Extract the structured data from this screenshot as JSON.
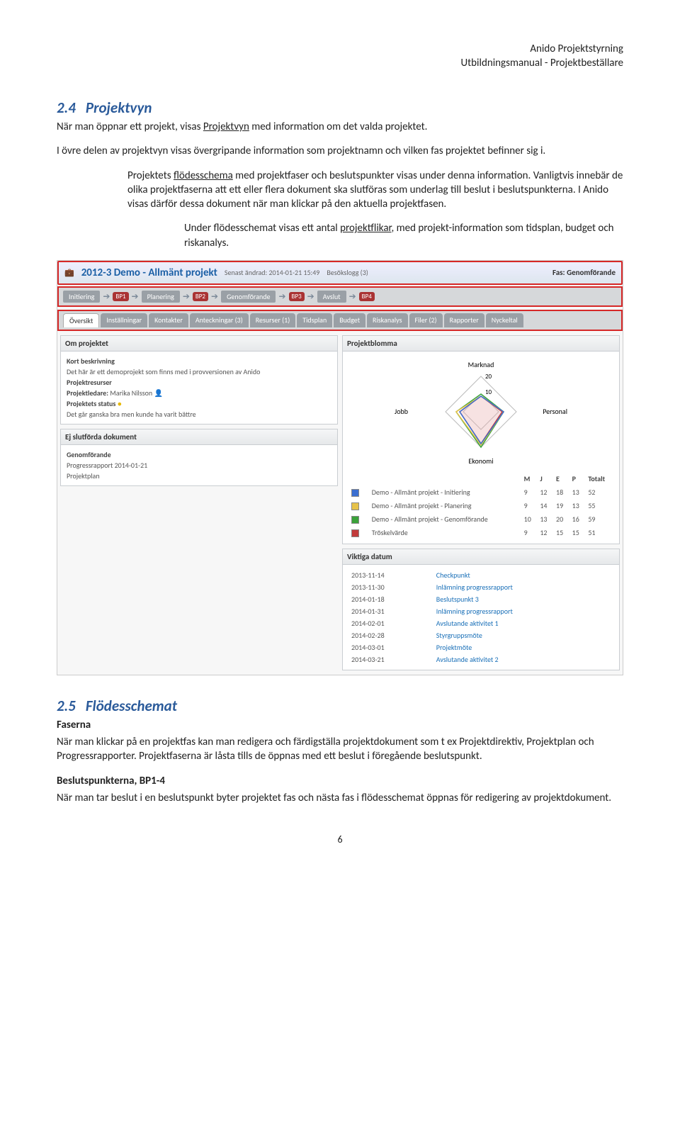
{
  "header": {
    "l1": "Anido Projektstyrning",
    "l2": "Utbildningsmanual - Projektbeställare"
  },
  "s1": {
    "num": "2.4",
    "title": "Projektvyn",
    "p1a": "När man öppnar ett projekt, visas ",
    "p1u": "Projektvyn",
    "p1b": " med information om det valda projektet.",
    "p2": "I övre delen av projektvyn visas övergripande information som projektnamn och vilken fas projektet befinner sig i.",
    "p3a": "Projektets ",
    "p3u": "flödesschema",
    "p3b": " med projektfaser och beslutspunkter visas under denna information. Vanligtvis innebär de olika projektfaserna att ett eller flera dokument ska slutföras som underlag till beslut i beslutspunkterna. I Anido visas därför dessa dokument när man klickar på den aktuella projektfasen.",
    "p4a": "Under flödesschemat visas ett antal ",
    "p4u": "projektflikar",
    "p4b": ", med projekt-information som tidsplan, budget och riskanalys."
  },
  "shot": {
    "project": "2012-3 Demo - Allmänt projekt",
    "changed": "Senast ändrad: 2014-01-21 15:49",
    "log": "Besökslogg (3)",
    "fas": "Fas: Genomförande",
    "phases": [
      "Initiering",
      "BP1",
      "Planering",
      "BP2",
      "Genomförande",
      "BP3",
      "Avslut",
      "BP4"
    ],
    "tabs": [
      "Översikt",
      "Inställningar",
      "Kontakter",
      "Anteckningar (3)",
      "Resurser (1)",
      "Tidsplan",
      "Budget",
      "Riskanalys",
      "Filer (2)",
      "Rapporter",
      "Nyckeltal"
    ],
    "about": {
      "title": "Om projektet",
      "kort_lbl": "Kort beskrivning",
      "kort": "Det här är ett demoprojekt som finns med i provversionen av Anido",
      "res_lbl": "Projektresurser",
      "leader_lbl": "Projektledare:",
      "leader": "Marika Nilsson",
      "status_lbl": "Projektets status",
      "status": "Det går ganska bra men kunde ha varit bättre"
    },
    "docs": {
      "title": "Ej slutförda dokument",
      "phase": "Genomförande",
      "d1": "Progressrapport 2014-01-21",
      "d2": "Projektplan"
    },
    "blom": {
      "title": "Projektblomma",
      "axes": {
        "top": "Marknad",
        "right": "Personal",
        "bottom": "Ekonomi",
        "left": "Jobb",
        "r1": "20",
        "r2": "10"
      },
      "cols": [
        "M",
        "J",
        "E",
        "P",
        "Totalt"
      ],
      "rows": [
        {
          "c": "#3b6fd1",
          "n": "Demo - Allmänt projekt - Initiering",
          "v": [
            "9",
            "12",
            "18",
            "13",
            "52"
          ]
        },
        {
          "c": "#e6c24a",
          "n": "Demo - Allmänt projekt - Planering",
          "v": [
            "9",
            "14",
            "19",
            "13",
            "55"
          ]
        },
        {
          "c": "#3aa23a",
          "n": "Demo - Allmänt projekt - Genomförande",
          "v": [
            "10",
            "13",
            "20",
            "16",
            "59"
          ]
        },
        {
          "c": "#c23b3b",
          "n": "Tröskelvärde",
          "v": [
            "9",
            "12",
            "15",
            "15",
            "51"
          ]
        }
      ]
    },
    "dates": {
      "title": "Viktiga datum",
      "rows": [
        {
          "d": "2013-11-14",
          "t": "Checkpunkt"
        },
        {
          "d": "2013-11-30",
          "t": "Inlämning progressrapport"
        },
        {
          "d": "2014-01-18",
          "t": "Beslutspunkt 3"
        },
        {
          "d": "2014-01-31",
          "t": "Inlämning progressrapport"
        },
        {
          "d": "2014-02-01",
          "t": "Avslutande aktivitet 1"
        },
        {
          "d": "2014-02-28",
          "t": "Styrgruppsmöte"
        },
        {
          "d": "2014-03-01",
          "t": "Projektmöte"
        },
        {
          "d": "2014-03-21",
          "t": "Avslutande aktivitet 2"
        }
      ]
    }
  },
  "s2": {
    "num": "2.5",
    "title": "Flödesschemat",
    "h1": "Faserna",
    "p1": "När man klickar på en projektfas kan man redigera och färdigställa projektdokument som t ex Projektdirektiv, Projektplan och Progressrapporter. Projektfaserna är låsta tills de öppnas med ett beslut i föregående beslutspunkt.",
    "h2": "Beslutspunkterna, BP1-4",
    "p2": "När man tar beslut i en beslutspunkt byter projektet fas och nästa fas i flödesschemat öppnas för redigering av projektdokument."
  },
  "footer": "6",
  "chart_data": {
    "type": "radar",
    "title": "Projektblomma",
    "categories": [
      "Marknad",
      "Jobb",
      "Ekonomi",
      "Personal"
    ],
    "ticks": [
      10,
      20
    ],
    "series": [
      {
        "name": "Demo - Allmänt projekt - Initiering",
        "color": "#3b6fd1",
        "values": [
          9,
          12,
          18,
          13
        ],
        "total": 52
      },
      {
        "name": "Demo - Allmänt projekt - Planering",
        "color": "#e6c24a",
        "values": [
          9,
          14,
          19,
          13
        ],
        "total": 55
      },
      {
        "name": "Demo - Allmänt projekt - Genomförande",
        "color": "#3aa23a",
        "values": [
          10,
          13,
          20,
          16
        ],
        "total": 59
      },
      {
        "name": "Tröskelvärde",
        "color": "#c23b3b",
        "values": [
          9,
          12,
          15,
          15
        ],
        "total": 51
      }
    ]
  }
}
